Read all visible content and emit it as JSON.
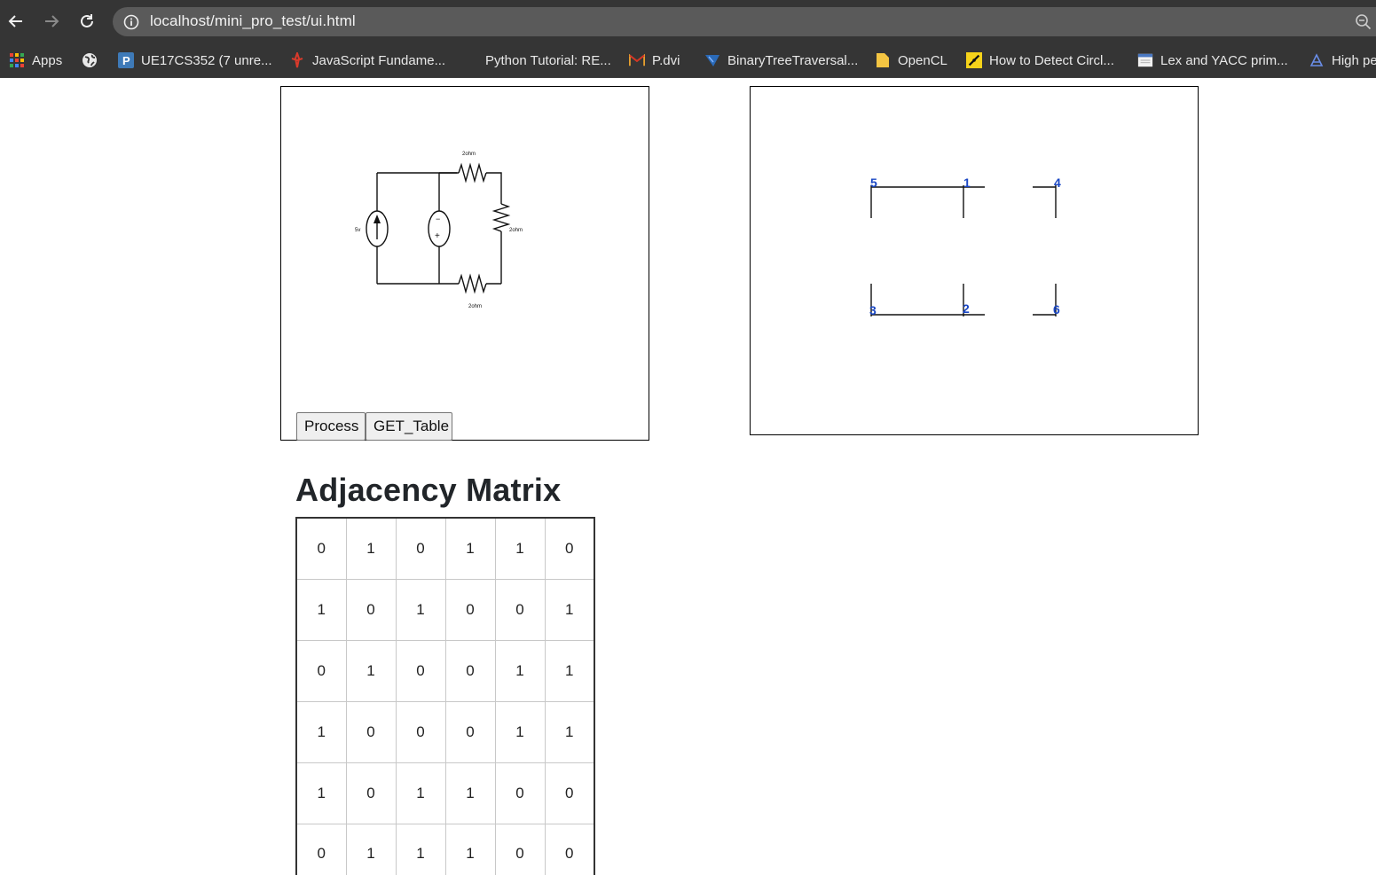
{
  "browser": {
    "url": "localhost/mini_pro_test/ui.html",
    "bookmarks": [
      {
        "label": "Apps",
        "icon": "apps-grid-icon"
      },
      {
        "label": "",
        "icon": "globe-icon"
      },
      {
        "label": "UE17CS352 (7 unre...",
        "icon": "piazza-icon"
      },
      {
        "label": "JavaScript Fundame...",
        "icon": "js-icon"
      },
      {
        "label": "Python Tutorial: RE...",
        "icon": "blank-icon"
      },
      {
        "label": "P.dvi",
        "icon": "gmail-icon"
      },
      {
        "label": "BinaryTreeTraversal...",
        "icon": "tree-icon"
      },
      {
        "label": "OpenCL",
        "icon": "folder-icon"
      },
      {
        "label": "How to Detect Circl...",
        "icon": "pyimage-icon"
      },
      {
        "label": "Lex and YACC prim...",
        "icon": "page-icon"
      },
      {
        "label": "High pe",
        "icon": "highperf-icon"
      }
    ]
  },
  "circuit": {
    "source_label": "5v",
    "top_resistor": "2ohm",
    "right_resistor": "2ohm",
    "bottom_resistor": "2ohm",
    "dep_source_top": "−",
    "dep_source_bottom": "+"
  },
  "graph": {
    "nodes": [
      "5",
      "1",
      "4",
      "3",
      "2",
      "6"
    ]
  },
  "buttons": {
    "process": "Process",
    "get_table": "GET_Table"
  },
  "matrix": {
    "title": "Adjacency Matrix",
    "rows": [
      [
        "0",
        "1",
        "0",
        "1",
        "1",
        "0"
      ],
      [
        "1",
        "0",
        "1",
        "0",
        "0",
        "1"
      ],
      [
        "0",
        "1",
        "0",
        "0",
        "1",
        "1"
      ],
      [
        "1",
        "0",
        "0",
        "0",
        "1",
        "1"
      ],
      [
        "1",
        "0",
        "1",
        "1",
        "0",
        "0"
      ],
      [
        "0",
        "1",
        "1",
        "1",
        "0",
        "0"
      ]
    ]
  },
  "colors": {
    "node_label": "#1a47c4",
    "chrome_bg": "#353535",
    "omnibox_bg": "#5a5a5a"
  }
}
